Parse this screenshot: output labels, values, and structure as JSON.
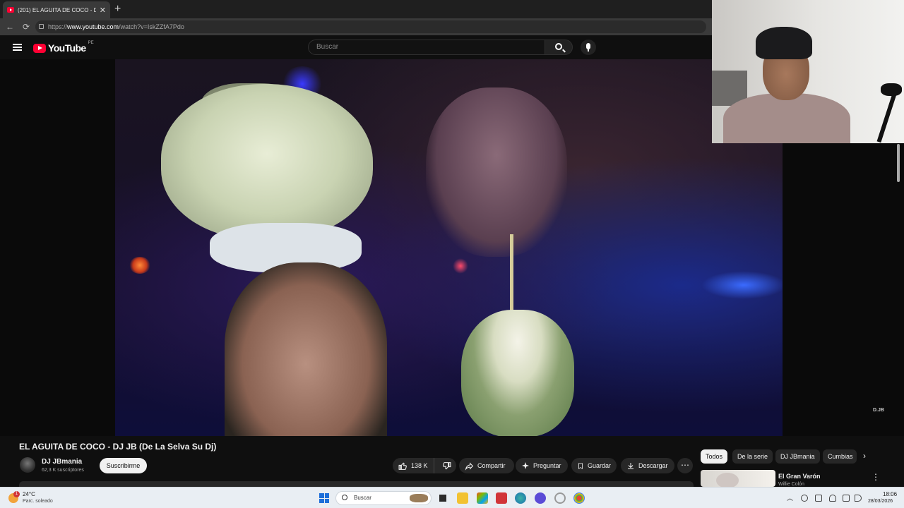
{
  "browser": {
    "tab_title": "(201) EL AGUITA DE COCO - D",
    "url_prefix": "https://",
    "url_host": "www.youtube.com",
    "url_path": "/watch?v=IskZZfA7Pdo"
  },
  "masthead": {
    "logo_text": "YouTube",
    "country_code": "PE",
    "search_placeholder": "Buscar"
  },
  "video": {
    "title": "EL AGUITA DE COCO - DJ JB (De La Selva Su Dj)",
    "watermark": "D.JB",
    "channel_name": "DJ JBmania",
    "subscribers": "62,3 K suscriptores",
    "subscribe_label": "Suscribirme",
    "likes": "138 K",
    "share_label": "Compartir",
    "ask_label": "Preguntar",
    "save_label": "Guardar",
    "download_label": "Descargar",
    "more_label": "⋯"
  },
  "chips": [
    "Todos",
    "De la serie",
    "DJ JBmania",
    "Cumbias"
  ],
  "related": {
    "title": "El Gran Varón",
    "channel": "Willie Colón"
  },
  "taskbar": {
    "weather_badge": "1",
    "temperature": "24°C",
    "condition": "Parc. soleado",
    "search_label": "Buscar",
    "time": "18:06",
    "date": "28/03/2026"
  },
  "colors": {
    "youtube_red": "#ff0033",
    "page_bg": "#0f0f0f",
    "taskbar_bg": "#e9eef3"
  }
}
